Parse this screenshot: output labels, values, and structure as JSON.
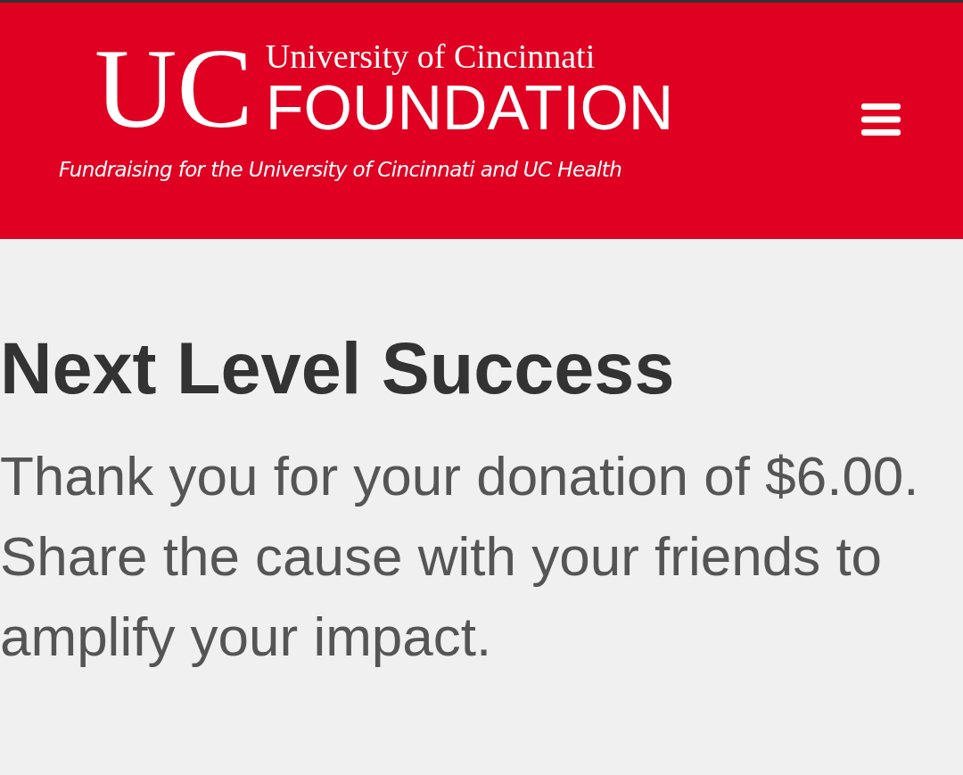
{
  "header": {
    "logo": {
      "monogram": "UC",
      "line_1": "University of Cincinnati",
      "line_2": "FOUNDATION",
      "tagline": "Fundraising for the University of Cincinnati and UC Health"
    }
  },
  "content": {
    "title": "Next Level Success",
    "message": "Thank you for your donation of $6.00. Share the cause with your friends to amplify your impact."
  }
}
